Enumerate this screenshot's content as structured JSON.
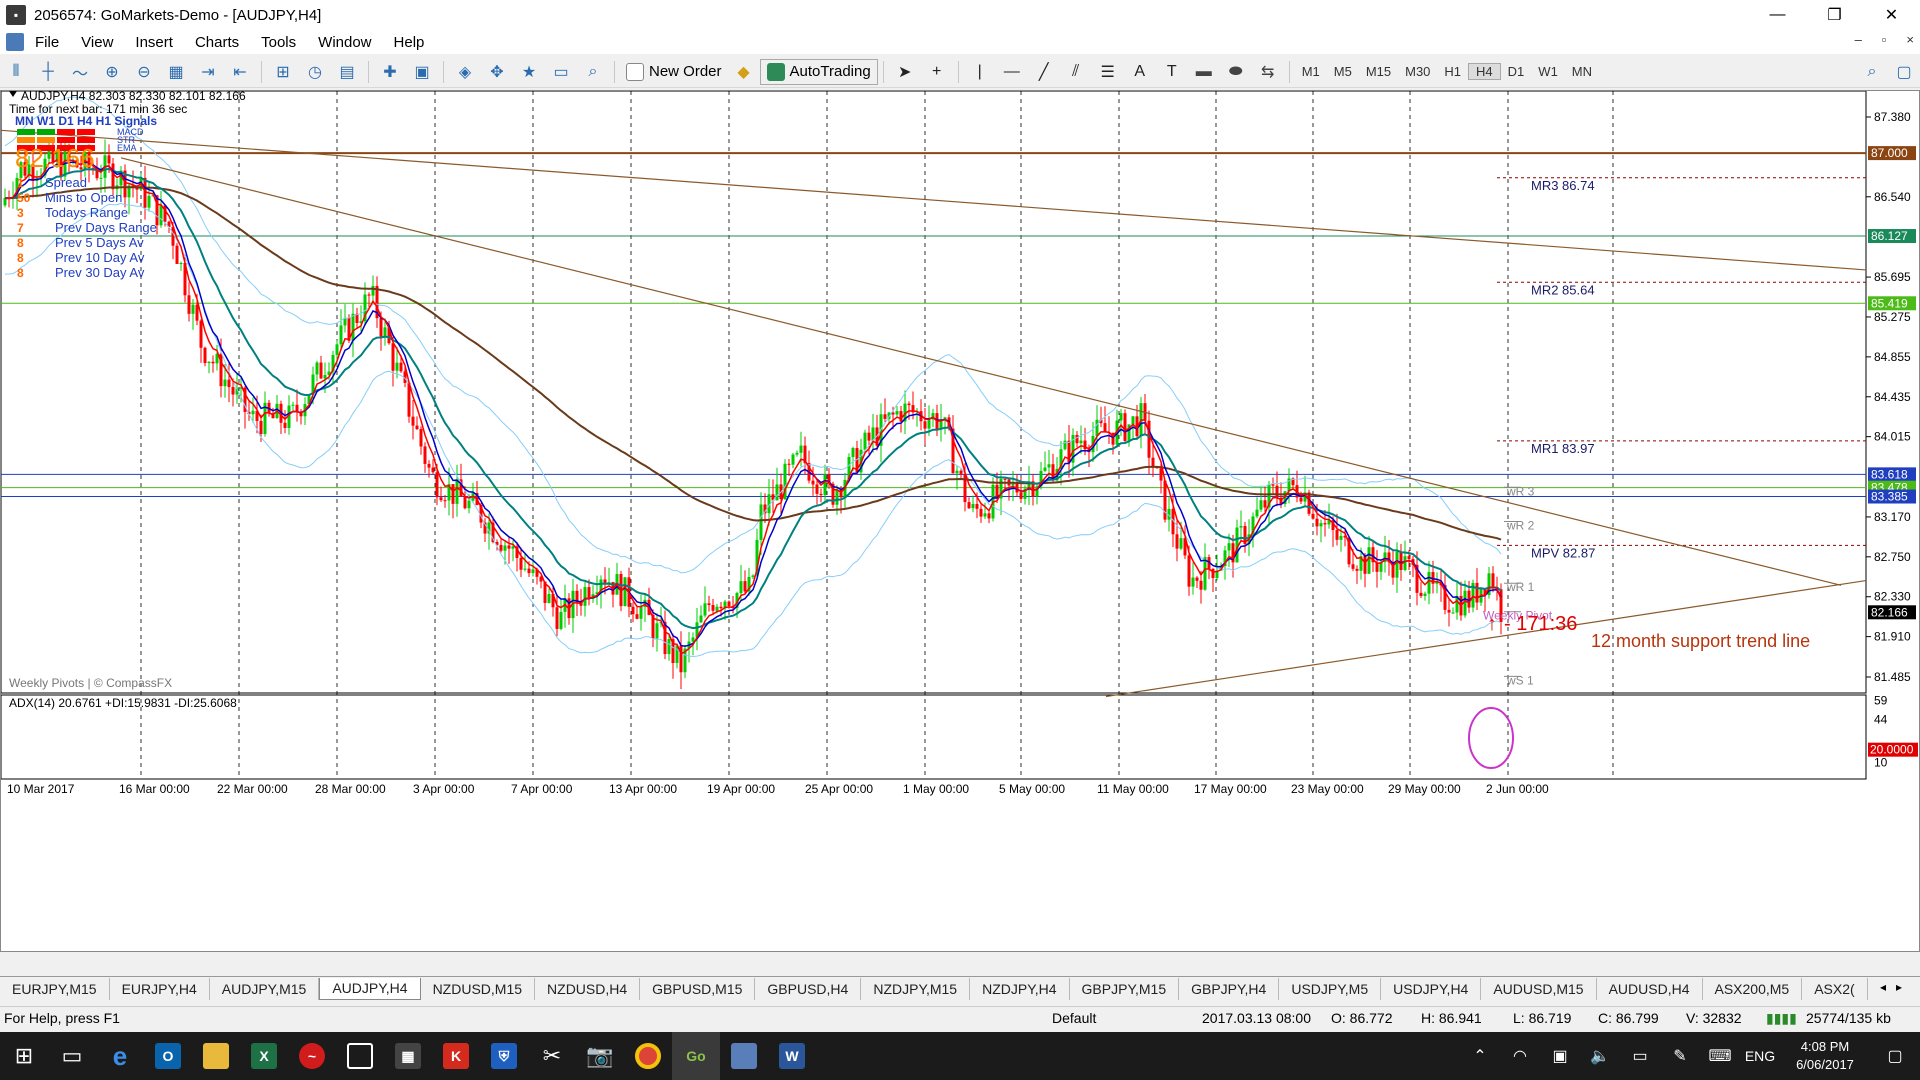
{
  "window": {
    "title": "2056574: GoMarkets-Demo - [AUDJPY,H4]",
    "minimize": "—",
    "restore": "❐",
    "close": "✕"
  },
  "menu": [
    "File",
    "View",
    "Insert",
    "Charts",
    "Tools",
    "Window",
    "Help"
  ],
  "toolbar": {
    "new_order": "New Order",
    "autotrading": "AutoTrading",
    "timeframes": [
      "M1",
      "M5",
      "M15",
      "M30",
      "H1",
      "H4",
      "D1",
      "W1",
      "MN"
    ],
    "active_timeframe": "H4"
  },
  "chart": {
    "header": "AUDJPY,H4  82.303  82.330  82.101  82.166",
    "next_bar": "Time for next bar: 171 min 36 sec",
    "indicator_tf": "MN W1 D1  H4  H1  Signals",
    "indicator_names": [
      "MACD",
      "STR",
      "EMA"
    ],
    "big_price": "82.166",
    "stats_labels": [
      "Spread",
      "Mins to Open",
      "Todays Range",
      "Prev Days Range",
      "Prev 5 Days Av",
      "Prev 10 Day Av",
      "Prev 30 Day Av"
    ],
    "stats_values": [
      "1",
      "50",
      "3",
      "7",
      "8",
      "8",
      "8"
    ],
    "watermark": "Weekly Pivots | © CompassFX",
    "price_ticks": [
      "87.380",
      "86.540",
      "85.695",
      "85.275",
      "84.855",
      "84.435",
      "84.015",
      "83.170",
      "82.750",
      "82.330",
      "81.910",
      "81.485"
    ],
    "price_tags": [
      {
        "value": "87.000",
        "color": "#8b4513"
      },
      {
        "value": "86.127",
        "color": "#1a8a5a"
      },
      {
        "value": "85.419",
        "color": "#4cbb17"
      },
      {
        "value": "83.618",
        "color": "#1f3fbf"
      },
      {
        "value": "83.478",
        "color": "#4cbb17"
      },
      {
        "value": "83.385",
        "color": "#1f3fbf"
      },
      {
        "value": "82.166",
        "color": "#000000"
      }
    ],
    "pivots": [
      {
        "label": "MR3",
        "value": "86.74"
      },
      {
        "label": "MR2",
        "value": "85.64"
      },
      {
        "label": "MR1",
        "value": "83.97"
      },
      {
        "label": "MPV",
        "value": "82.87"
      }
    ],
    "weekly_pivots": [
      "wR 3",
      "wR 2",
      "wR 1",
      "Weekly Pivot",
      "wS 1"
    ],
    "annotation_arrow": "↑",
    "annotation_count": "- 171:36",
    "annotation_text": "12 month support trend line",
    "adx_label": "ADX(14) 20.6761 +DI:15.9831 -DI:25.6068",
    "adx_ticks": [
      "59",
      "44",
      "10"
    ],
    "adx_tag": "20.0000",
    "date_labels": [
      "10 Mar 2017",
      "16 Mar 00:00",
      "22 Mar 00:00",
      "28 Mar 00:00",
      "3 Apr 00:00",
      "7 Apr 00:00",
      "13 Apr 00:00",
      "19 Apr 00:00",
      "25 Apr 00:00",
      "1 May 00:00",
      "5 May 00:00",
      "11 May 00:00",
      "17 May 00:00",
      "23 May 00:00",
      "29 May 00:00",
      "2 Jun 00:00"
    ],
    "colors": {
      "candle_up": "#00cc00",
      "candle_down": "#ff0000",
      "ema_fast": "#ff0000",
      "ema_mid": "#0000cc",
      "ema_slow": "#008080",
      "ma200": "#6b3a1a",
      "bollinger": "#87cefa",
      "trendline": "#8b5a2b"
    }
  },
  "tabs": [
    "EURJPY,M15",
    "EURJPY,H4",
    "AUDJPY,M15",
    "AUDJPY,H4",
    "NZDUSD,M15",
    "NZDUSD,H4",
    "GBPUSD,M15",
    "GBPUSD,H4",
    "NZDJPY,M15",
    "NZDJPY,H4",
    "GBPJPY,M15",
    "GBPJPY,H4",
    "USDJPY,M5",
    "USDJPY,H4",
    "AUDUSD,M15",
    "AUDUSD,H4",
    "ASX200,M5",
    "ASX2("
  ],
  "active_tab": "AUDJPY,H4",
  "status": {
    "help": "For Help, press F1",
    "profile": "Default",
    "datetime": "2017.03.13 08:00",
    "open": "O: 86.772",
    "high": "H: 86.941",
    "low": "L: 86.719",
    "close": "C: 86.799",
    "volume": "V: 32832",
    "traffic": "25774/135 kb"
  },
  "taskbar": {
    "lang": "ENG",
    "time": "4:08 PM",
    "date": "6/06/2017"
  }
}
